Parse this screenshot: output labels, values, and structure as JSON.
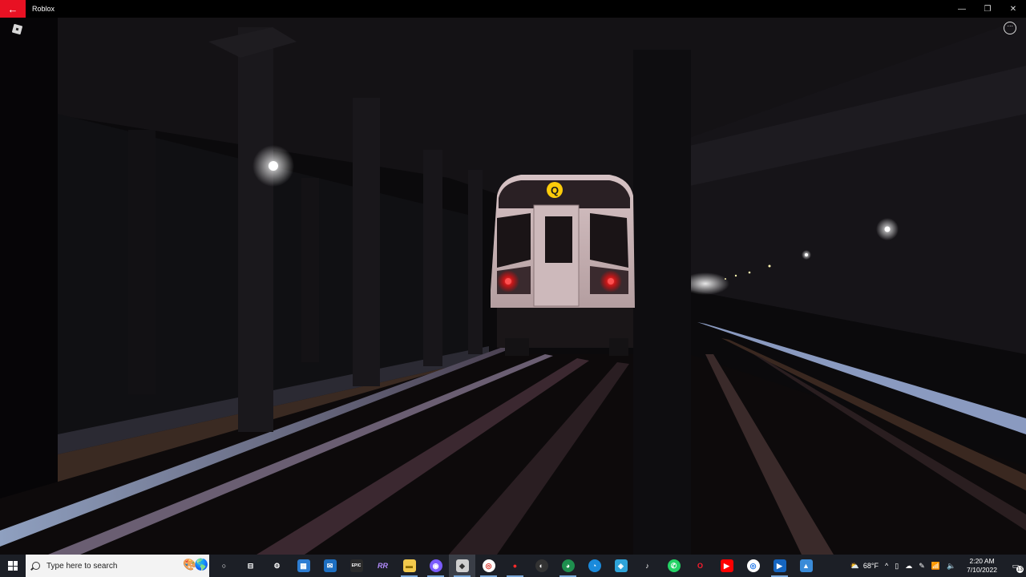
{
  "window": {
    "title": "Roblox",
    "back_glyph": "←",
    "minimize_glyph": "—",
    "maximize_glyph": "❐",
    "close_glyph": "✕"
  },
  "game": {
    "scene": "subway tunnel with approaching train",
    "train_route_letter": "Q",
    "route_color": "#fccc0a",
    "more_glyph": "···"
  },
  "taskbar": {
    "search_placeholder": "Type here to search",
    "pinned": [
      {
        "name": "task-view",
        "glyph": "○"
      },
      {
        "name": "multitasking",
        "glyph": "⊟"
      },
      {
        "name": "settings",
        "glyph": "⚙"
      },
      {
        "name": "store",
        "glyph": "▦"
      },
      {
        "name": "mail",
        "glyph": "✉"
      },
      {
        "name": "epic-games",
        "glyph": "EPIC"
      },
      {
        "name": "rr",
        "glyph": "RR"
      },
      {
        "name": "file-explorer",
        "glyph": "▬"
      },
      {
        "name": "discord",
        "glyph": "◉"
      },
      {
        "name": "roblox",
        "glyph": "◆"
      },
      {
        "name": "chrome",
        "glyph": "◎"
      },
      {
        "name": "recorder",
        "glyph": "●"
      },
      {
        "name": "obs",
        "glyph": "◐"
      },
      {
        "name": "edge-dev",
        "glyph": "◕"
      },
      {
        "name": "edge",
        "glyph": "◔"
      },
      {
        "name": "app-blue",
        "glyph": "◈"
      },
      {
        "name": "tiktok",
        "glyph": "♪"
      },
      {
        "name": "whatsapp",
        "glyph": "✆"
      },
      {
        "name": "opera",
        "glyph": "O"
      },
      {
        "name": "youtube",
        "glyph": "▶"
      },
      {
        "name": "chrome-2",
        "glyph": "◎"
      },
      {
        "name": "media-player",
        "glyph": "▶"
      },
      {
        "name": "photos",
        "glyph": "▲"
      }
    ],
    "weather": "68°F",
    "time": "2:20 AM",
    "date": "7/10/2022",
    "notification_count": "13"
  },
  "colors": {
    "accent_red": "#e81123",
    "taskbar_bg": "#1c1f26",
    "train_body": "#c9b4b6",
    "tail_light": "#ff2020"
  }
}
